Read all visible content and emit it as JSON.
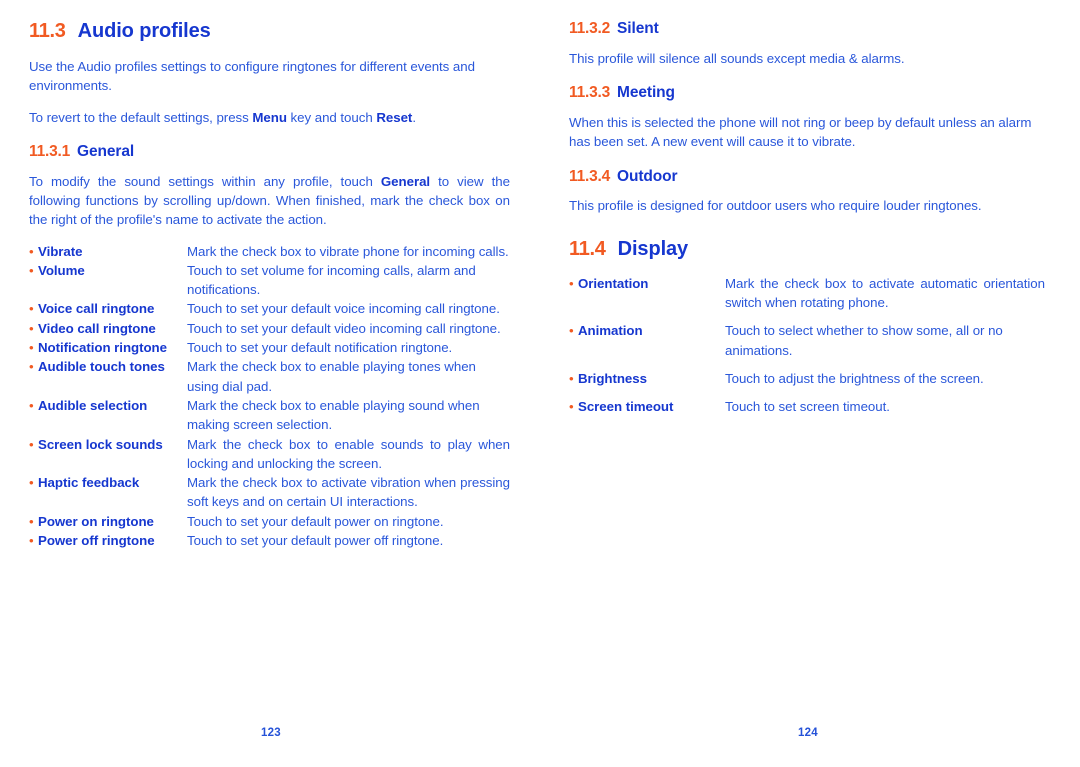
{
  "theme": {
    "accent_orange": "#f15a22",
    "heading_blue": "#1637cf",
    "body_blue": "#2a57da",
    "background": "#ffffff"
  },
  "left_page": {
    "page_number": "123",
    "section": {
      "number": "11.3",
      "title": "Audio profiles"
    },
    "intro_paragraphs": [
      "Use the Audio profiles settings to configure ringtones for different events and environments."
    ],
    "revert_paragraph": {
      "before": "To revert to the default settings, press ",
      "bold1": "Menu",
      "middle": " key and touch ",
      "bold2": "Reset",
      "after": "."
    },
    "subsection": {
      "number": "11.3.1",
      "title": "General"
    },
    "subsection_paragraph": {
      "before": "To modify the sound settings within any profile, touch ",
      "bold1": "General",
      "after": " to view the following functions by scrolling up/down. When finished, mark the check box on the right of the profile's name to activate the action."
    },
    "bullet_char": "•",
    "items": [
      {
        "term": "Vibrate",
        "desc": "Mark the check box to vibrate phone for incoming calls.",
        "justify": false
      },
      {
        "term": "Volume",
        "desc": "Touch to set volume for incoming calls, alarm and notifications.",
        "justify": false
      },
      {
        "term": "Voice call ringtone",
        "desc": "Touch to set your default voice incoming call ringtone.",
        "justify": true
      },
      {
        "term": "Video call ringtone",
        "desc": "Touch to set your default video incoming call ringtone.",
        "justify": true
      },
      {
        "term": "Notification ringtone",
        "desc": "Touch to set your default notification ringtone.",
        "justify": false
      },
      {
        "term": "Audible touch tones",
        "desc": "Mark the check box to enable playing tones when using dial pad.",
        "justify": false
      },
      {
        "term": "Audible selection",
        "desc": "Mark the check box to enable playing sound when making screen selection.",
        "justify": false
      },
      {
        "term": "Screen lock sounds",
        "desc": "Mark the check box to enable sounds to play when locking and unlocking the screen.",
        "justify": true
      },
      {
        "term": "Haptic feedback",
        "desc": "Mark the check box to activate vibration when pressing soft keys and on certain UI interactions.",
        "justify": true
      },
      {
        "term": "Power on ringtone",
        "desc": "Touch to set your default power on ringtone.",
        "justify": false
      },
      {
        "term": "Power off ringtone",
        "desc": "Touch to set your default power off ringtone.",
        "justify": false
      }
    ]
  },
  "right_page": {
    "page_number": "124",
    "subsections": [
      {
        "number": "11.3.2",
        "title": "Silent",
        "paragraph": "This profile will silence all sounds except media & alarms."
      },
      {
        "number": "11.3.3",
        "title": "Meeting",
        "paragraph": "When this is selected the phone will not ring or beep by default unless an alarm has been set. A new event will cause it to vibrate."
      },
      {
        "number": "11.3.4",
        "title": "Outdoor",
        "paragraph": "This profile is designed for outdoor users who require louder ringtones."
      }
    ],
    "section": {
      "number": "11.4",
      "title": "Display"
    },
    "bullet_char": "•",
    "items": [
      {
        "term": "Orientation",
        "desc": "Mark the check box to activate automatic orientation switch when rotating phone.",
        "justify": true
      },
      {
        "term": "Animation",
        "desc": "Touch to select whether to show some, all or no animations.",
        "justify": false
      },
      {
        "term": "Brightness",
        "desc": "Touch to adjust the brightness of the screen.",
        "justify": false
      },
      {
        "term": "Screen timeout",
        "desc": "Touch to set screen timeout.",
        "justify": false
      }
    ]
  }
}
